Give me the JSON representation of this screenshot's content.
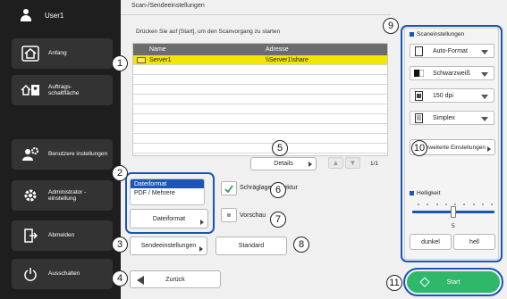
{
  "sidebar": {
    "user_name": "User1",
    "home_label": "Anfang",
    "job_button_label": "Auftrags-\nschaltfläche",
    "user_settings_label": "Benutzere instellungen",
    "admin_settings_label": "Administrator -\neinstellung",
    "logout_label": "Abmelden",
    "power_off_label": "Ausschalten"
  },
  "main": {
    "title": "Scan-/Sendeeinstellungen",
    "instruction": "Drücken Sie auf [Start], um den Scanvorgang zu starten",
    "table": {
      "headers": [
        "Name",
        "Adresse"
      ],
      "rows": [
        {
          "name": "Server1",
          "address": "\\\\Server1\\share",
          "selected": true
        }
      ]
    },
    "details_label": "Details",
    "page_indicator": "1/1",
    "file_format": {
      "options": [
        "Dateiformat",
        "PDF / Mehrere"
      ],
      "button_label": "Dateiformat"
    },
    "skew_label": "Schräglage korrektur",
    "preview_label": "Vorschau",
    "send_settings_label": "Sendeeinstellungen",
    "standard_label": "Standard",
    "back_label": "Zurück"
  },
  "settings": {
    "heading": "Scaneinstellungen",
    "dropdowns": [
      {
        "value": "Auto-Format",
        "icon": "page-icon"
      },
      {
        "value": "Schwarzweiß",
        "icon": "black-white-icon"
      },
      {
        "value": "150 dpi",
        "icon": "resolution-icon"
      },
      {
        "value": "Simplex",
        "icon": "simplex-icon"
      }
    ],
    "advanced_label": "Erweiterte Einstellungen",
    "brightness": {
      "heading": "Helligkeit",
      "value": "5",
      "level": 5,
      "min": 1,
      "max": 9
    },
    "dark_label": "dunkel",
    "light_label": "hell"
  },
  "start_label": "Start",
  "callouts": [
    "1",
    "2",
    "3",
    "4",
    "5",
    "6",
    "7",
    "8",
    "9",
    "10",
    "11"
  ],
  "colors": {
    "accent": "#1a56b8",
    "selection": "#f2e500",
    "start": "#2fb86a",
    "sidebar": "#1e1e1e"
  }
}
